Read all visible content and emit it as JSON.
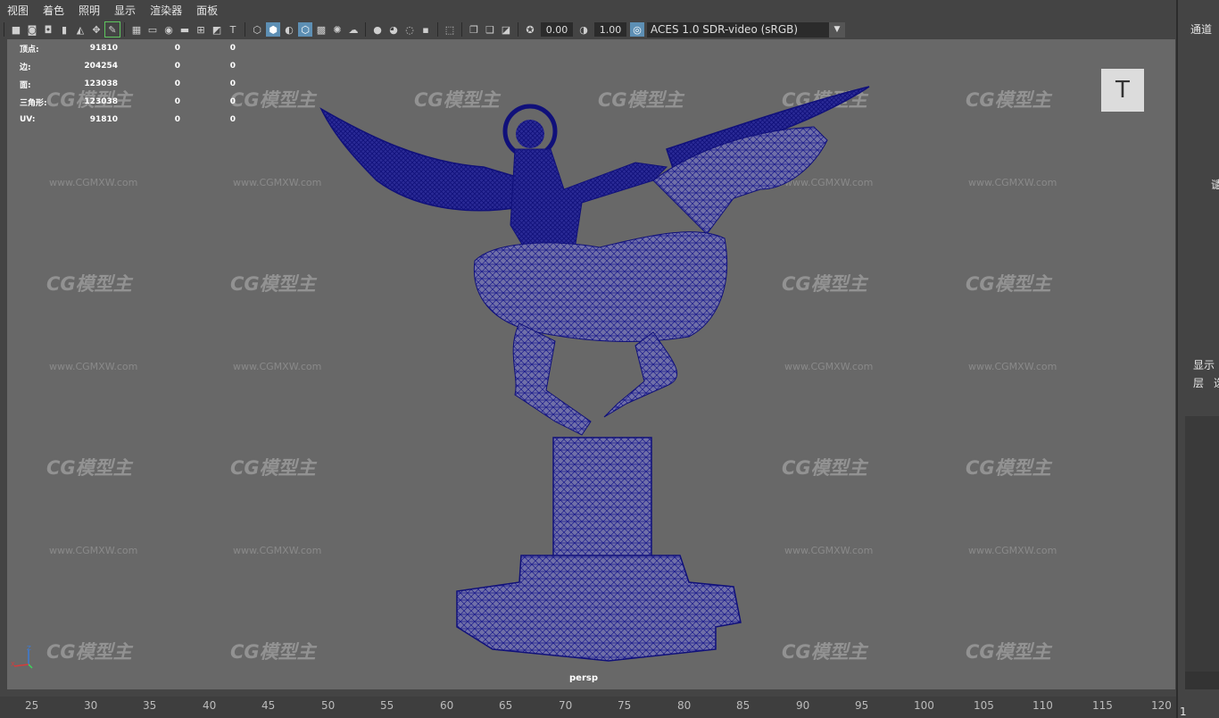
{
  "menu": [
    "视图",
    "着色",
    "照明",
    "显示",
    "渲染器",
    "面板"
  ],
  "toolbar": {
    "exposure": "0.00",
    "gamma": "1.00",
    "colorspace": "ACES 1.0 SDR-video (sRGB)"
  },
  "hud": [
    {
      "label": "顶点:",
      "v1": "91810",
      "v2": "0",
      "v3": "0"
    },
    {
      "label": "边:",
      "v1": "204254",
      "v2": "0",
      "v3": "0"
    },
    {
      "label": "面:",
      "v1": "123038",
      "v2": "0",
      "v3": "0"
    },
    {
      "label": "三角形:",
      "v1": "123038",
      "v2": "0",
      "v3": "0"
    },
    {
      "label": "UV:",
      "v1": "91810",
      "v2": "0",
      "v3": "0"
    }
  ],
  "viewcube_label": "T",
  "camera_label": "persp",
  "axis": {
    "z": "Z",
    "x": "X"
  },
  "watermark": {
    "logo": "CG模型主",
    "url": "www.CGMXW.com"
  },
  "timeline": [
    "25",
    "30",
    "35",
    "40",
    "45",
    "50",
    "55",
    "60",
    "65",
    "70",
    "75",
    "80",
    "85",
    "90",
    "95",
    "100",
    "105",
    "110",
    "115",
    "120"
  ],
  "right_panel": {
    "channel": "通道",
    "partial": "谴",
    "display": "显示",
    "layer": "层",
    "layer_partial": "选",
    "frame": "1"
  },
  "colors": {
    "mesh": "#1a1a8c",
    "viewport": "#686868",
    "panel": "#444444"
  }
}
